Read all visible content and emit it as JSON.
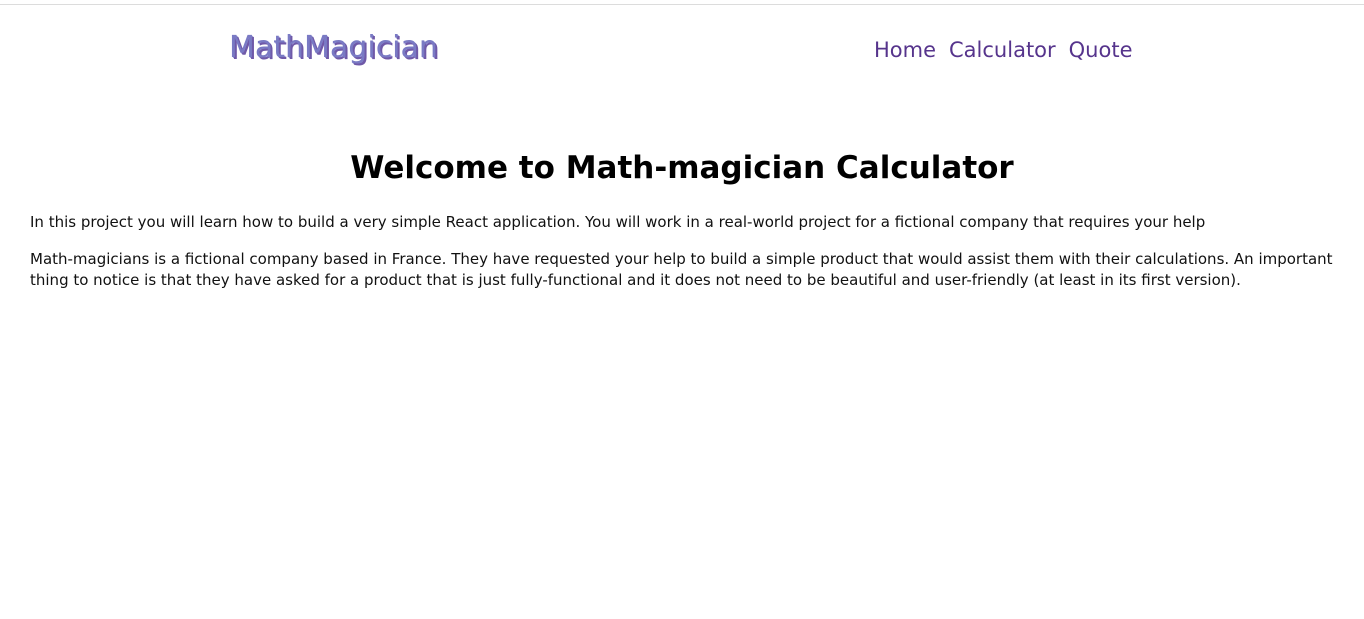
{
  "header": {
    "logo": "MathMagician",
    "nav": {
      "home": "Home",
      "calculator": "Calculator",
      "quote": "Quote"
    }
  },
  "main": {
    "title": "Welcome to Math-magician Calculator",
    "paragraph1": "In this project you will learn how to build a very simple React application. You will work in a real-world project for a fictional company that requires your help",
    "paragraph2": "Math-magicians is a fictional company based in France. They have requested your help to build a simple product that would assist them with their calculations. An important thing to notice is that they have asked for a product that is just fully-functional and it does not need to be beautiful and user-friendly (at least in its first version)."
  },
  "colors": {
    "logo": "#7a7ac4",
    "nav_link": "#56348c",
    "heading": "#000000"
  }
}
